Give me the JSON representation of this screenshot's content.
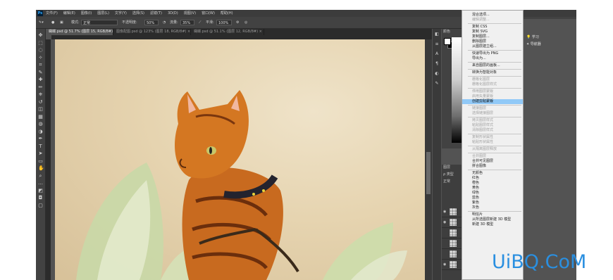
{
  "menubar": {
    "items": [
      "文件(F)",
      "编辑(E)",
      "图像(I)",
      "图层(L)",
      "文字(Y)",
      "选择(S)",
      "滤镜(T)",
      "3D(D)",
      "视图(V)",
      "窗口(W)",
      "帮助(H)"
    ]
  },
  "options": {
    "mode_label": "模式:",
    "mode_value": "正常",
    "opacity_label": "不透明度:",
    "opacity_value": "50%",
    "flow_label": "流量:",
    "flow_value": "35%",
    "smooth_label": "平滑:",
    "smooth_value": "100%"
  },
  "tabs": [
    {
      "label": "蝴蝶.psd @ 51.7% (图层 15, RGB/8#) ×"
    },
    {
      "label": "图像配图.psd @ 123% (图层 18, RGB/8#) ×"
    },
    {
      "label": "蝴蝶.psd @ 51.1% (图层 12, RGB/8#) ×"
    }
  ],
  "toolbar": {
    "icons": [
      "move-icon",
      "marquee-icon",
      "lasso-icon",
      "magic-wand-icon",
      "crop-icon",
      "eyedropper-icon",
      "healing-icon",
      "brush-icon",
      "stamp-icon",
      "history-brush-icon",
      "eraser-icon",
      "gradient-icon",
      "blur-icon",
      "dodge-icon",
      "pen-icon",
      "type-icon",
      "path-select-icon",
      "shape-icon",
      "hand-icon",
      "zoom-icon",
      "more-icon",
      "fg-bg-icon",
      "quickmask-icon",
      "screenmode-icon"
    ]
  },
  "color_panel": {
    "tab": "颜色"
  },
  "layers_panel": {
    "tab": "图层",
    "filter": "ρ 类型",
    "blend": "正常"
  },
  "context_menu": {
    "items": [
      {
        "label": "混合选项...",
        "disabled": false
      },
      {
        "label": "编辑调整...",
        "disabled": true
      },
      {
        "sep": true
      },
      {
        "label": "复制 CSS",
        "disabled": false
      },
      {
        "label": "复制 SVG",
        "disabled": false
      },
      {
        "label": "复制图层...",
        "disabled": false
      },
      {
        "label": "删除图层",
        "disabled": false
      },
      {
        "label": "从图层建立组...",
        "disabled": false
      },
      {
        "sep": true
      },
      {
        "label": "快速导出为 PNG",
        "disabled": false
      },
      {
        "label": "导出为...",
        "disabled": false
      },
      {
        "sep": true
      },
      {
        "label": "来自图层的画板...",
        "disabled": false
      },
      {
        "sep": true
      },
      {
        "label": "转换为智能对象",
        "disabled": false
      },
      {
        "sep": true
      },
      {
        "label": "栅格化图层",
        "disabled": true
      },
      {
        "label": "栅格化图层样式",
        "disabled": true
      },
      {
        "sep": true
      },
      {
        "label": "停用图层蒙版",
        "disabled": true
      },
      {
        "label": "启用矢量蒙版",
        "disabled": true
      },
      {
        "label": "创建剪贴蒙版",
        "disabled": false,
        "selected": true
      },
      {
        "sep": true
      },
      {
        "label": "链接图层",
        "disabled": true
      },
      {
        "label": "选择链接图层",
        "disabled": true
      },
      {
        "sep": true
      },
      {
        "label": "拷贝图层样式",
        "disabled": true
      },
      {
        "label": "粘贴图层样式",
        "disabled": true
      },
      {
        "label": "清除图层样式",
        "disabled": true
      },
      {
        "sep": true
      },
      {
        "label": "复制形状属性",
        "disabled": true
      },
      {
        "label": "粘贴形状属性",
        "disabled": true
      },
      {
        "sep": true
      },
      {
        "label": "从隔离图层释放",
        "disabled": true
      },
      {
        "sep": true
      },
      {
        "label": "合并图层",
        "disabled": true
      },
      {
        "label": "合并可见图层",
        "disabled": false
      },
      {
        "label": "拼合图像",
        "disabled": false
      },
      {
        "sep": true
      },
      {
        "label": "无颜色",
        "disabled": false
      },
      {
        "label": "红色",
        "disabled": false
      },
      {
        "label": "橙色",
        "disabled": false
      },
      {
        "label": "黄色",
        "disabled": false
      },
      {
        "label": "绿色",
        "disabled": false
      },
      {
        "label": "蓝色",
        "disabled": false
      },
      {
        "label": "紫色",
        "disabled": false
      },
      {
        "label": "灰色",
        "disabled": false
      },
      {
        "sep": true
      },
      {
        "label": "明信片",
        "disabled": false
      },
      {
        "label": "从所选图层新建 3D 模型",
        "disabled": false
      },
      {
        "label": "新建 3D 模型",
        "disabled": false
      }
    ]
  },
  "far_panel": {
    "items": [
      "学习",
      "导航器"
    ]
  },
  "watermark": "UiBQ.CoM"
}
